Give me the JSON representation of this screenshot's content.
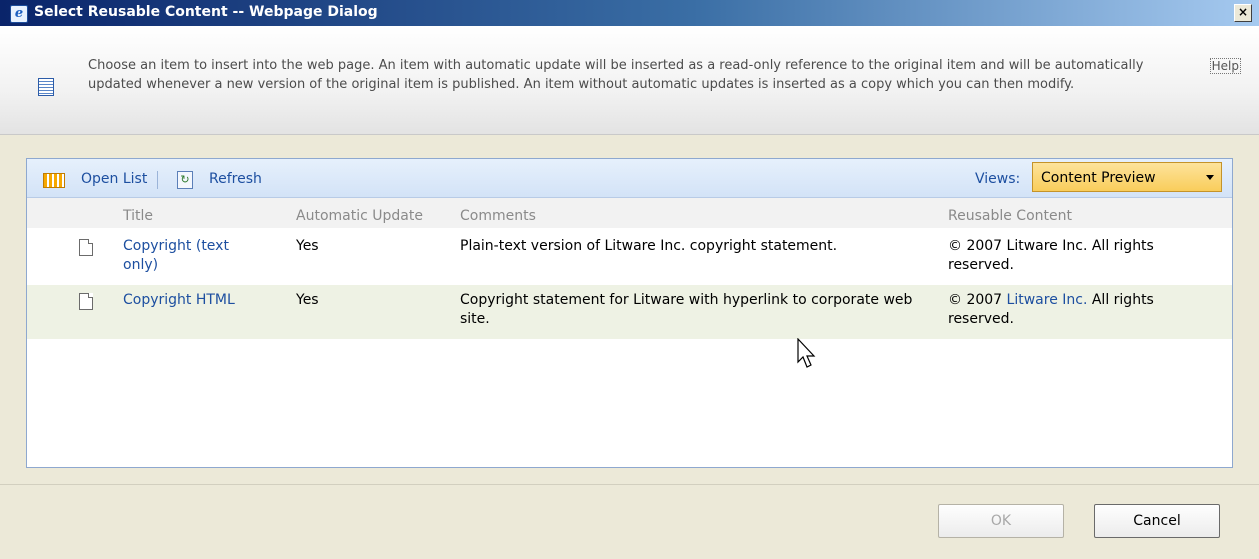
{
  "window": {
    "title": "Select Reusable Content -- Webpage Dialog",
    "close_glyph": "×"
  },
  "info": {
    "message": "Choose an item to insert into the web page. An item with automatic update will be inserted as a read-only reference to the original item and will be automatically updated whenever a new version of the original item is published. An item without automatic updates is inserted as a copy which you can then modify.",
    "help_label": "Help"
  },
  "toolbar": {
    "open_list_label": "Open List",
    "refresh_label": "Refresh",
    "views_label": "Views:",
    "views_selected": "Content Preview"
  },
  "table": {
    "headers": [
      "Title",
      "Automatic Update",
      "Comments",
      "Reusable Content"
    ],
    "rows": [
      {
        "title": "Copyright (text only)",
        "auto_update": "Yes",
        "comments": "Plain-text version of Litware Inc. copyright statement.",
        "reusable_prefix": "© 2007 Litware Inc. All rights reserved.",
        "reusable_link": "",
        "reusable_suffix": ""
      },
      {
        "title": "Copyright HTML",
        "auto_update": "Yes",
        "comments": "Copyright statement for Litware with hyperlink to corporate web site.",
        "reusable_prefix": "© 2007 ",
        "reusable_link": "Litware Inc.",
        "reusable_suffix": " All rights reserved."
      }
    ]
  },
  "footer": {
    "ok_label": "OK",
    "cancel_label": "Cancel",
    "ok_enabled": false
  },
  "icons": [
    "ie-icon",
    "close-icon",
    "document-list-icon",
    "help-icon",
    "list-icon",
    "refresh-icon",
    "dropdown-arrow-icon",
    "document-icon",
    "mouse-cursor-icon"
  ],
  "colors": {
    "titlebar_start": "#0a246a",
    "link": "#1d4fa0",
    "views_select": "#f9cd5b",
    "alt_row": "#eef2e4"
  }
}
